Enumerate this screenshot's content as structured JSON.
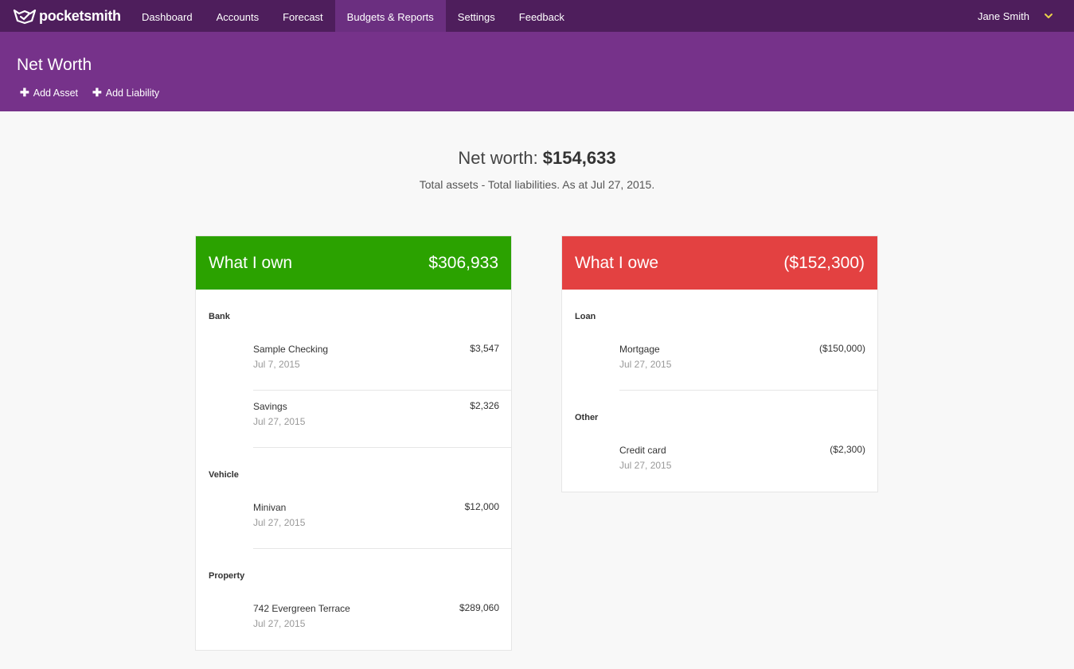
{
  "nav": {
    "logo_text": "pocketsmith",
    "items": [
      {
        "label": "Dashboard"
      },
      {
        "label": "Accounts"
      },
      {
        "label": "Forecast"
      },
      {
        "label": "Budgets & Reports",
        "active": true
      },
      {
        "label": "Settings"
      },
      {
        "label": "Feedback"
      }
    ],
    "user_name": "Jane Smith"
  },
  "header": {
    "title": "Net Worth",
    "add_asset": "Add Asset",
    "add_liability": "Add Liability"
  },
  "summary": {
    "label": "Net worth: ",
    "value": "$154,633",
    "subtitle": "Total assets - Total liabilities. As at Jul 27, 2015."
  },
  "own": {
    "title": "What I own",
    "total": "$306,933",
    "groups": [
      {
        "label": "Bank",
        "rows": [
          {
            "name": "Sample Checking",
            "date": "Jul 7, 2015",
            "amount": "$3,547"
          },
          {
            "name": "Savings",
            "date": "Jul 27, 2015",
            "amount": "$2,326"
          }
        ]
      },
      {
        "label": "Vehicle",
        "rows": [
          {
            "name": "Minivan",
            "date": "Jul 27, 2015",
            "amount": "$12,000"
          }
        ]
      },
      {
        "label": "Property",
        "rows": [
          {
            "name": "742 Evergreen Terrace",
            "date": "Jul 27, 2015",
            "amount": "$289,060"
          }
        ]
      }
    ]
  },
  "owe": {
    "title": "What I owe",
    "total": "($152,300)",
    "groups": [
      {
        "label": "Loan",
        "rows": [
          {
            "name": "Mortgage",
            "date": "Jul 27, 2015",
            "amount": "($150,000)"
          }
        ]
      },
      {
        "label": "Other",
        "rows": [
          {
            "name": "Credit card",
            "date": "Jul 27, 2015",
            "amount": "($2,300)"
          }
        ]
      }
    ]
  },
  "colors": {
    "nav_bg": "#4e1e5c",
    "header_bg": "#76328a",
    "own_green": "#2ba200",
    "owe_red": "#e34141"
  },
  "icons": [
    "pocketsmith-logo-icon",
    "chevron-down-icon",
    "plus-icon"
  ]
}
